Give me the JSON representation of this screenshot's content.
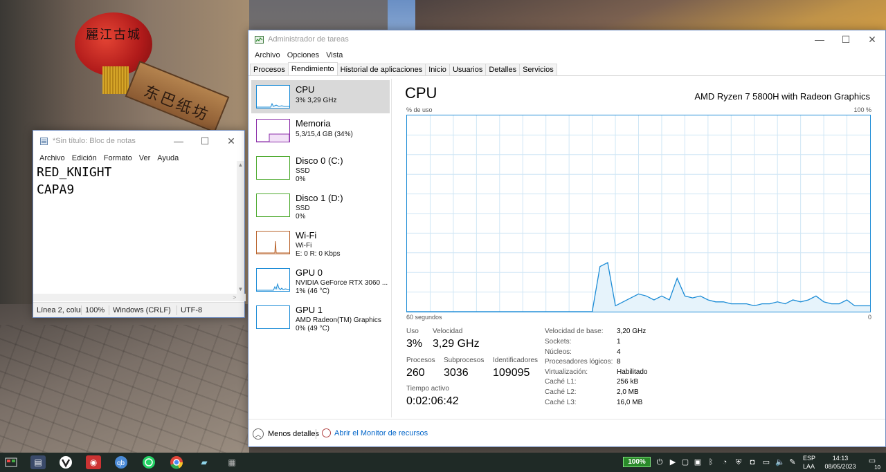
{
  "desktop": {
    "lantern_text": "麗江古城",
    "sign_text": "东巴纸坊"
  },
  "notepad": {
    "title": "*Sin título: Bloc de notas",
    "menu": [
      "Archivo",
      "Edición",
      "Formato",
      "Ver",
      "Ayuda"
    ],
    "lines": [
      "RED_KNIGHT",
      "CAPA9"
    ],
    "status": {
      "position": "Línea 2, colum",
      "zoom": "100%",
      "eol": "Windows (CRLF)",
      "encoding": "UTF-8"
    }
  },
  "taskmgr": {
    "title": "Administrador de tareas",
    "menu": [
      "Archivo",
      "Opciones",
      "Vista"
    ],
    "tabs": [
      "Procesos",
      "Rendimiento",
      "Historial de aplicaciones",
      "Inicio",
      "Usuarios",
      "Detalles",
      "Servicios"
    ],
    "active_tab": "Rendimiento",
    "resources": [
      {
        "name": "CPU",
        "lines": [
          "3% 3,29 GHz"
        ],
        "color": "#1a8bd6",
        "selected": true
      },
      {
        "name": "Memoria",
        "lines": [
          "5,3/15,4 GB (34%)"
        ],
        "color": "#8b2ea8"
      },
      {
        "name": "Disco 0 (C:)",
        "lines": [
          "SSD",
          "0%"
        ],
        "color": "#4daa2e"
      },
      {
        "name": "Disco 1 (D:)",
        "lines": [
          "SSD",
          "0%"
        ],
        "color": "#4daa2e"
      },
      {
        "name": "Wi-Fi",
        "lines": [
          "Wi-Fi",
          "E: 0 R: 0 Kbps"
        ],
        "color": "#b8622a"
      },
      {
        "name": "GPU 0",
        "lines": [
          "NVIDIA GeForce RTX 3060 ...",
          "1% (46 °C)"
        ],
        "color": "#1a8bd6"
      },
      {
        "name": "GPU 1",
        "lines": [
          "AMD Radeon(TM) Graphics",
          "0% (49 °C)"
        ],
        "color": "#1a8bd6"
      }
    ],
    "cpu": {
      "heading": "CPU",
      "model": "AMD Ryzen 7 5800H with Radeon Graphics",
      "y_label": "% de uso",
      "y_max_label": "100 %",
      "x_label_left": "60 segundos",
      "x_label_right": "0",
      "stats": {
        "uso_label": "Uso",
        "uso": "3%",
        "velocidad_label": "Velocidad",
        "velocidad": "3,29 GHz",
        "procesos_label": "Procesos",
        "procesos": "260",
        "subprocesos_label": "Subprocesos",
        "subprocesos": "3036",
        "identificadores_label": "Identificadores",
        "identificadores": "109095",
        "tiempo_label": "Tiempo activo",
        "tiempo": "0:02:06:42"
      },
      "specs": [
        {
          "label": "Velocidad de base:",
          "value": "3,20 GHz"
        },
        {
          "label": "Sockets:",
          "value": "1"
        },
        {
          "label": "Núcleos:",
          "value": "4"
        },
        {
          "label": "Procesadores lógicos:",
          "value": "8"
        },
        {
          "label": "Virtualización:",
          "value": "Habilitado"
        },
        {
          "label": "Caché L1:",
          "value": "256 kB"
        },
        {
          "label": "Caché L2:",
          "value": "2,0 MB"
        },
        {
          "label": "Caché L3:",
          "value": "16,0 MB"
        }
      ]
    },
    "footer": {
      "fewer_details": "Menos detalles",
      "resource_monitor": "Abrir el Monitor de recursos"
    }
  },
  "chart_data": {
    "type": "area",
    "x": [
      60,
      59,
      58,
      57,
      56,
      55,
      54,
      53,
      52,
      51,
      50,
      49,
      48,
      47,
      46,
      45,
      44,
      43,
      42,
      41,
      40,
      39,
      38,
      37,
      36,
      35,
      34,
      33,
      32,
      31,
      30,
      29,
      28,
      27,
      26,
      25,
      24,
      23,
      22,
      21,
      20,
      19,
      18,
      17,
      16,
      15,
      14,
      13,
      12,
      11,
      10,
      9,
      8,
      7,
      6,
      5,
      4,
      3,
      2,
      1,
      0
    ],
    "values": [
      0,
      0,
      0,
      0,
      0,
      0,
      0,
      0,
      0,
      0,
      0,
      0,
      0,
      0,
      0,
      0,
      0,
      0,
      0,
      0,
      0,
      0,
      0,
      0,
      0,
      23,
      25,
      3,
      5,
      7,
      9,
      8,
      6,
      8,
      6,
      17,
      8,
      7,
      8,
      6,
      5,
      5,
      4,
      4,
      4,
      3,
      4,
      4,
      5,
      4,
      6,
      5,
      6,
      8,
      5,
      4,
      4,
      6,
      3,
      3,
      3
    ],
    "xlabel": "60 segundos",
    "ylabel": "% de uso",
    "ylim": [
      0,
      100
    ],
    "xlim": [
      60,
      0
    ],
    "grid": true,
    "color": "#1a8bd6"
  },
  "taskbar": {
    "battery": "100%",
    "lang_top": "ESP",
    "lang_bottom": "LAA",
    "time": "14:13",
    "date": "08/05/2023",
    "notifications": "10"
  }
}
